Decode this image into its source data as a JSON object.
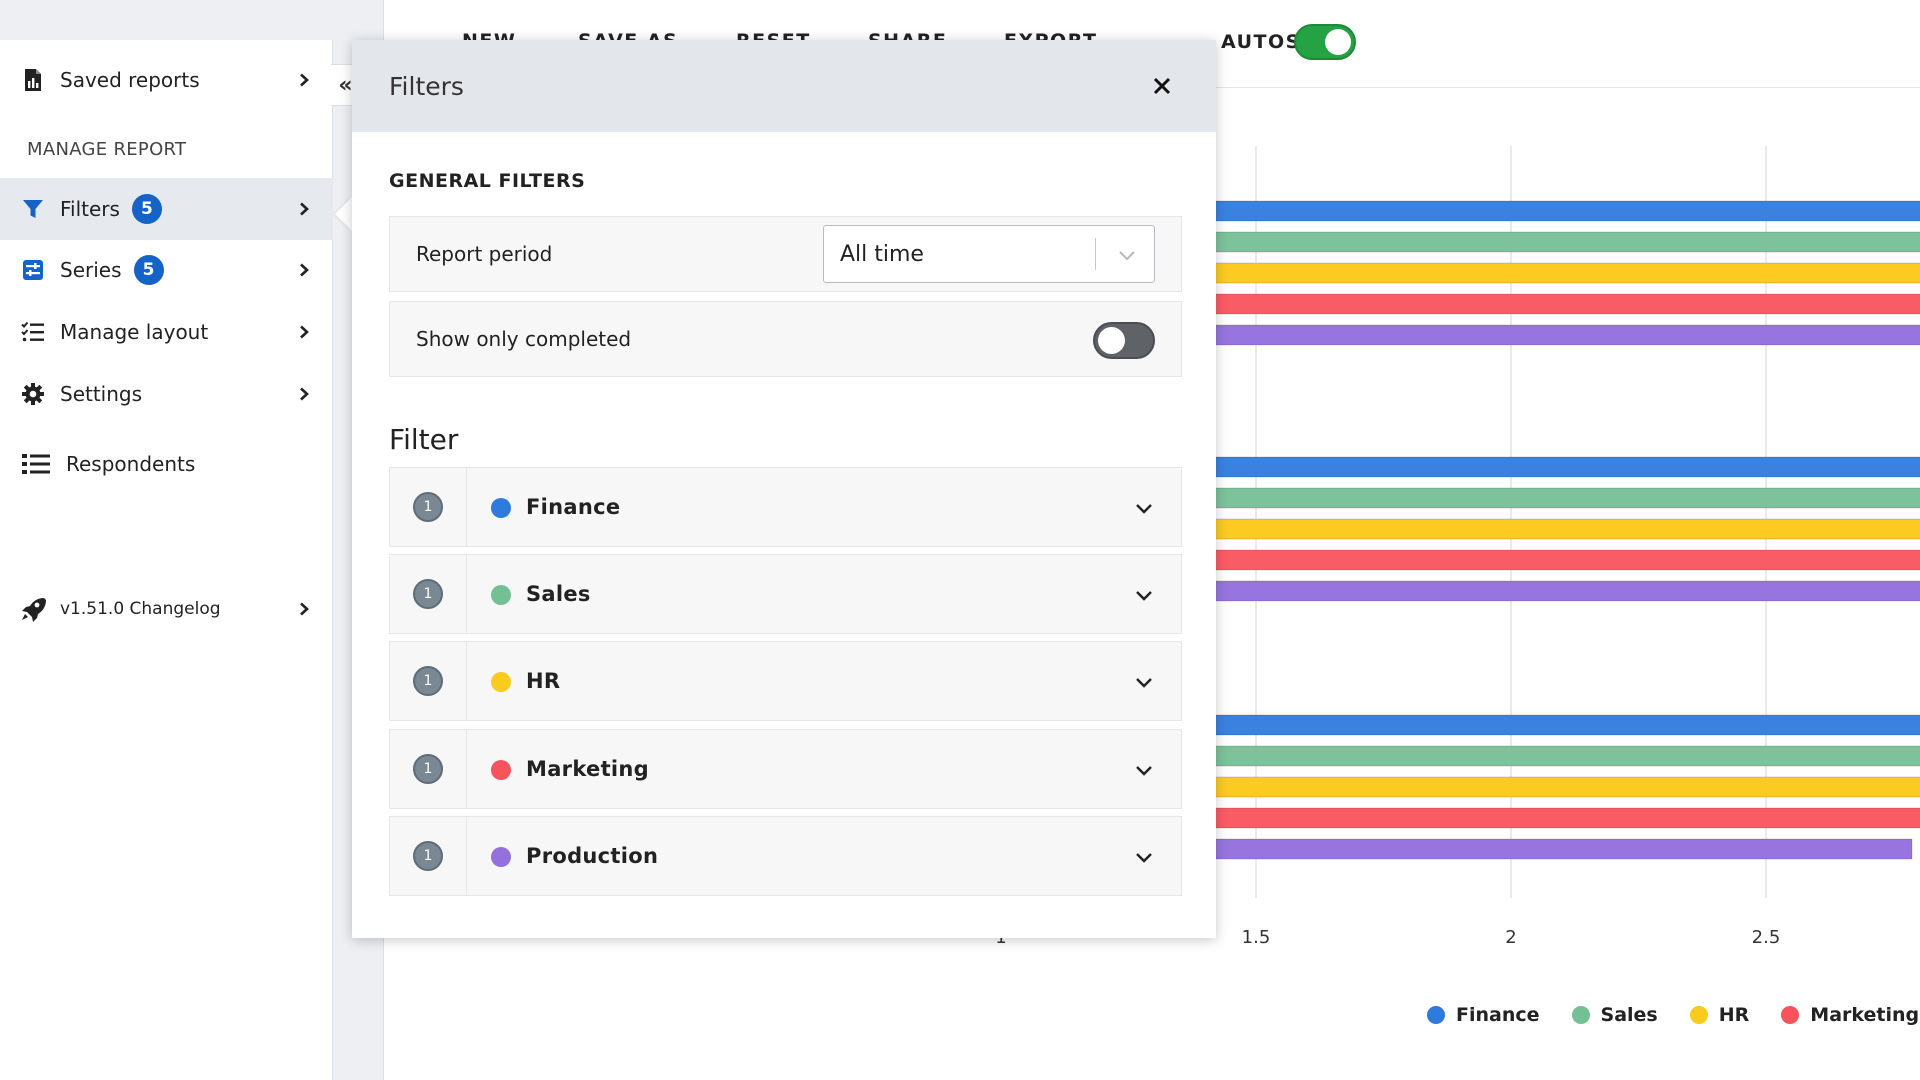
{
  "sidebar": {
    "items": [
      {
        "label": "Saved reports",
        "icon": "report-icon"
      },
      {
        "label": "Filters",
        "badge": "5",
        "icon": "filter-icon"
      },
      {
        "label": "Series",
        "badge": "5",
        "icon": "series-icon"
      },
      {
        "label": "Manage layout",
        "icon": "layout-list-icon"
      },
      {
        "label": "Settings",
        "icon": "gear-icon"
      },
      {
        "label": "Respondents",
        "icon": "list-icon"
      },
      {
        "label": "v1.51.0 Changelog",
        "icon": "rocket-icon"
      }
    ],
    "section_title": "MANAGE REPORT",
    "collapse_glyph": "«"
  },
  "toolbar": {
    "buttons": [
      "NEW",
      "SAVE AS",
      "RESET",
      "SHARE",
      "EXPORT"
    ],
    "autosave_label": "AUTOSAVE",
    "autosave_on": true
  },
  "panel": {
    "title": "Filters",
    "general_title": "GENERAL FILTERS",
    "report_period_label": "Report period",
    "report_period_value": "All time",
    "show_completed_label": "Show only completed",
    "show_completed_on": false,
    "filter_title": "Filter",
    "filters": [
      {
        "count": "1",
        "label": "Finance",
        "color": "#2e7bdb"
      },
      {
        "count": "1",
        "label": "Sales",
        "color": "#73c095"
      },
      {
        "count": "1",
        "label": "HR",
        "color": "#f8cb1c"
      },
      {
        "count": "1",
        "label": "Marketing",
        "color": "#f6535c"
      },
      {
        "count": "1",
        "label": "Production",
        "color": "#9370dc"
      }
    ]
  },
  "chart_data": {
    "type": "bar",
    "orientation": "horizontal",
    "x_ticks": [
      "1",
      "1.5",
      "2",
      "2.5"
    ],
    "series": [
      {
        "name": "Finance",
        "color": "#3b82e0"
      },
      {
        "name": "Sales",
        "color": "#7dc29b"
      },
      {
        "name": "HR",
        "color": "#fbcb22"
      },
      {
        "name": "Marketing",
        "color": "#fa5c66"
      },
      {
        "name": "Production",
        "color": "#9875de"
      }
    ],
    "legend": [
      "Finance",
      "Sales",
      "HR",
      "Marketing"
    ],
    "legend_position": "bottom-right",
    "grid": true
  }
}
